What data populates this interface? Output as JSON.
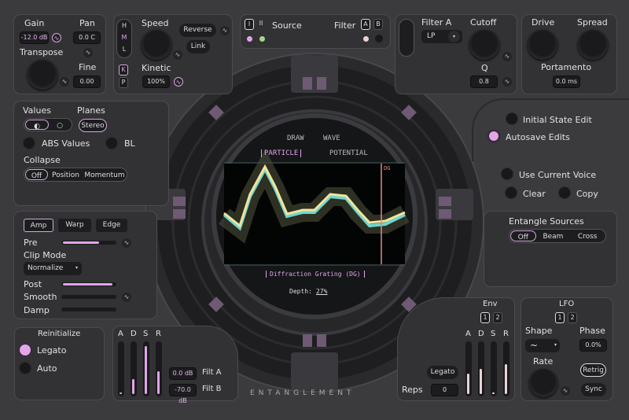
{
  "colors": {
    "accent": "#e0a6e8",
    "background": "#3b3b3e",
    "panel": "#323235",
    "wave_a": "#f3e39a",
    "wave_b": "#6fd6d0",
    "marker": "#e08a8a"
  },
  "voice": {
    "gain_label": "Gain",
    "gain_value": "-12.0 dB",
    "pan_label": "Pan",
    "pan_value": "0.0 C",
    "transpose_label": "Transpose",
    "fine_label": "Fine",
    "fine_value": "0.00"
  },
  "speed": {
    "h": "H",
    "m": "M",
    "l": "L",
    "k": "K",
    "p": "P",
    "speed_label": "Speed",
    "reverse": "Reverse",
    "link": "Link",
    "kinetic_label": "Kinetic",
    "kinetic_value": "100%"
  },
  "source": {
    "i": "I",
    "ii": "II",
    "label": "Source",
    "filter_label": "Filter",
    "a": "A",
    "b": "B"
  },
  "filter": {
    "label": "Filter A",
    "type": "LP",
    "cutoff_label": "Cutoff",
    "q_label": "Q",
    "q_value": "0.8"
  },
  "drive": {
    "drive_label": "Drive",
    "spread_label": "Spread",
    "portamento_label": "Portamento",
    "portamento_value": "0.0 ms"
  },
  "values": {
    "values_label": "Values",
    "planes_label": "Planes",
    "planes_value": "Stereo",
    "abs_label": "ABS Values",
    "bl_label": "BL",
    "collapse_label": "Collapse",
    "collapse_options": [
      "Off",
      "Position",
      "Momentum"
    ]
  },
  "amp": {
    "tabs": [
      "Amp",
      "Warp",
      "Edge"
    ],
    "pre_label": "Pre",
    "pre_level": 0.65,
    "clip_label": "Clip Mode",
    "clip_value": "Normalize",
    "post_label": "Post",
    "post_level": 0.9,
    "smooth_label": "Smooth",
    "smooth_level": 0,
    "damp_label": "Damp",
    "damp_level": 0
  },
  "reinit": {
    "title": "Reinitialize",
    "legato": "Legato",
    "auto": "Auto"
  },
  "adsr": {
    "letters": [
      "A",
      "D",
      "S",
      "R"
    ],
    "levels": [
      0.02,
      0.3,
      0.95,
      0.45
    ],
    "filt_a_value": "0.0 dB",
    "filt_a_label": "Filt A",
    "filt_b_value": "-70.0 dB",
    "filt_b_label": "Filt B"
  },
  "screen": {
    "tabs_top": [
      "DRAW",
      "WAVE"
    ],
    "tabs_bottom": [
      "PARTICLE",
      "POTENTIAL"
    ],
    "active_tab": "PARTICLE",
    "marker_label": "DG",
    "mode": "Diffraction Grating (DG)",
    "depth_label": "Depth:",
    "depth_value": "27%"
  },
  "brand": "ENTANGLEMENT",
  "right": {
    "initial_state": "Initial State Edit",
    "autosave": "Autosave Edits",
    "use_current_voice": "Use Current Voice",
    "clear": "Clear",
    "copy": "Copy",
    "entangle_label": "Entangle Sources",
    "entangle_options": [
      "Off",
      "Beam",
      "Cross"
    ]
  },
  "env": {
    "title": "Env",
    "tabs": [
      "1",
      "2"
    ],
    "letters": [
      "A",
      "D",
      "S",
      "R"
    ],
    "levels": [
      0.4,
      0.5,
      0.02,
      0.6
    ],
    "legato": "Legato",
    "reps_label": "Reps",
    "reps_value": "0"
  },
  "lfo": {
    "title": "LFO",
    "tabs": [
      "1",
      "2"
    ],
    "shape_label": "Shape",
    "shape_value": "~",
    "phase_label": "Phase",
    "phase_value": "0.0%",
    "rate_label": "Rate",
    "retrig": "Retrig",
    "sync": "Sync"
  }
}
